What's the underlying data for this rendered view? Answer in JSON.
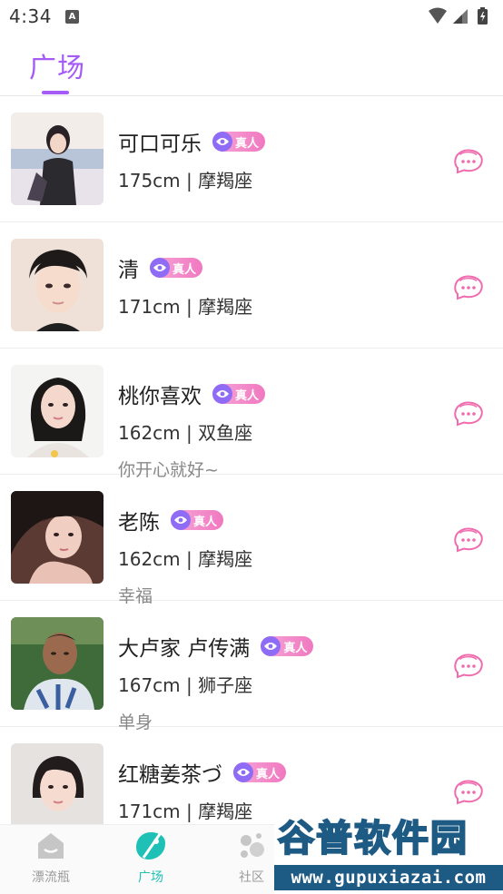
{
  "status_bar": {
    "time": "4:34",
    "notification_letter": "A"
  },
  "header": {
    "tab_title": "广场"
  },
  "users": [
    {
      "name": "可口可乐",
      "badge": "真人",
      "info": "175cm | 摩羯座",
      "sign": ""
    },
    {
      "name": "清",
      "badge": "真人",
      "info": "171cm | 摩羯座",
      "sign": ""
    },
    {
      "name": "桃你喜欢",
      "badge": "真人",
      "info": "162cm | 双鱼座",
      "sign": "你开心就好~"
    },
    {
      "name": "老陈",
      "badge": "真人",
      "info": "162cm | 摩羯座",
      "sign": "幸福"
    },
    {
      "name": "大卢家 卢传满",
      "badge": "真人",
      "info": "167cm | 狮子座",
      "sign": "单身"
    },
    {
      "name": "红糖姜茶づ",
      "badge": "真人",
      "info": "171cm | 摩羯座",
      "sign": ""
    }
  ],
  "tabbar": {
    "items": [
      {
        "label": "漂流瓶",
        "icon": "bottle-icon"
      },
      {
        "label": "广场",
        "icon": "plaza-icon"
      },
      {
        "label": "社区",
        "icon": "community-icon"
      }
    ],
    "active_index": 1
  },
  "watermark": {
    "title": "谷普软件园",
    "url": "www.gupuxiazai.com"
  },
  "colors": {
    "accent": "#a55cf6",
    "chat_icon": "#f06cae",
    "tab_active": "#1fc1b6",
    "badge_eye": "#8f6cf6"
  }
}
